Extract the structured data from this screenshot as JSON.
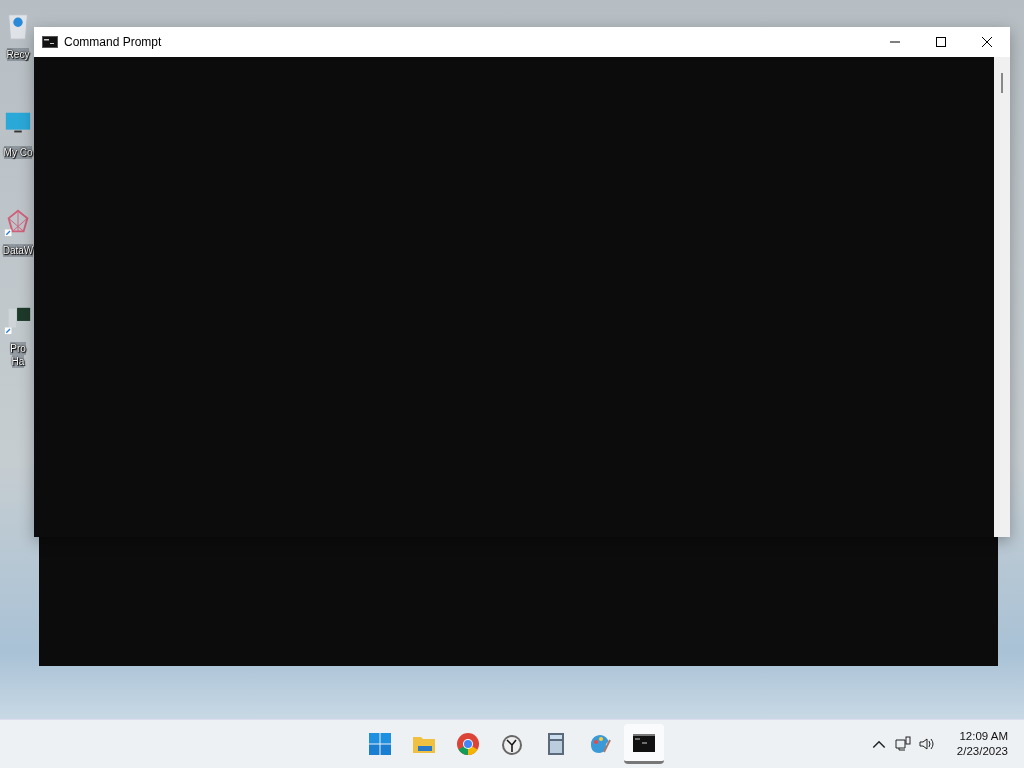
{
  "desktop_icons": [
    {
      "kind": "recycle",
      "lines": [
        "Recy"
      ]
    },
    {
      "kind": "monitor",
      "lines": [
        "My Co"
      ]
    },
    {
      "kind": "molecule",
      "lines": [
        "DataW"
      ]
    },
    {
      "kind": "hacker",
      "lines": [
        "Pro",
        "Ha"
      ]
    }
  ],
  "window": {
    "title": "Command Prompt"
  },
  "taskbar": {
    "apps": [
      {
        "kind": "start",
        "selected": false
      },
      {
        "kind": "folder",
        "selected": false
      },
      {
        "kind": "chrome",
        "selected": false
      },
      {
        "kind": "clock",
        "selected": false
      },
      {
        "kind": "calculator",
        "selected": false
      },
      {
        "kind": "paint",
        "selected": false
      },
      {
        "kind": "terminal",
        "selected": true
      }
    ],
    "time": "12:09 AM",
    "date": "2/23/2023"
  }
}
